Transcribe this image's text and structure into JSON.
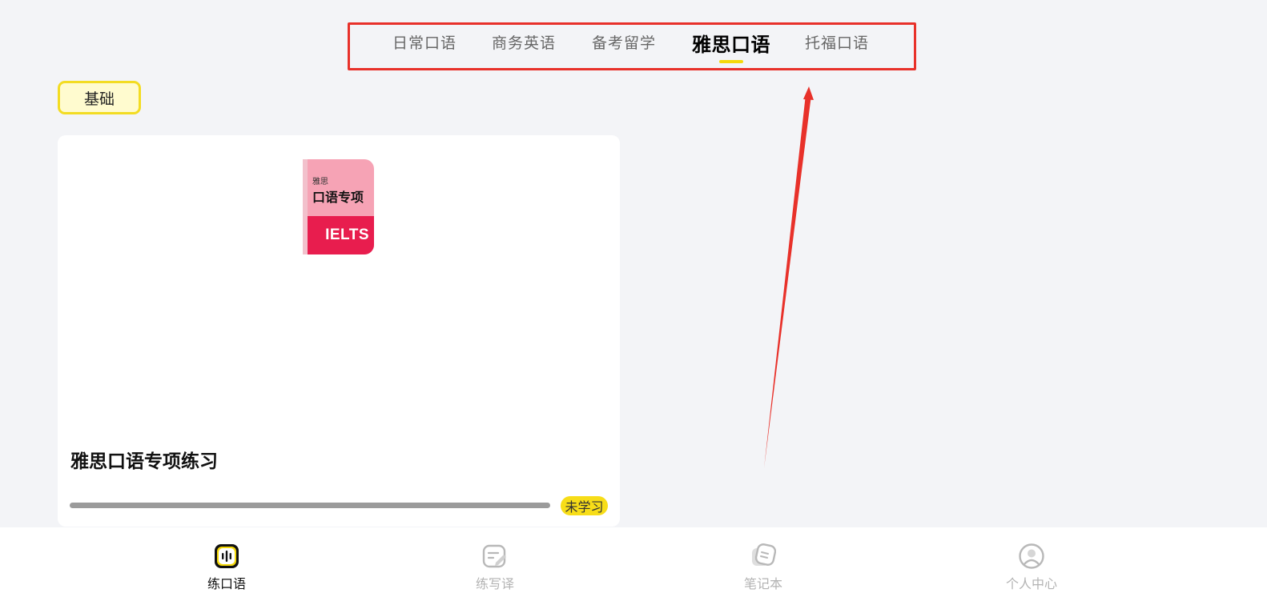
{
  "tabs": [
    {
      "label": "日常口语",
      "active": false
    },
    {
      "label": "商务英语",
      "active": false
    },
    {
      "label": "备考留学",
      "active": false
    },
    {
      "label": "雅思口语",
      "active": true
    },
    {
      "label": "托福口语",
      "active": false
    }
  ],
  "level_chip": {
    "label": "基础"
  },
  "course": {
    "cover_small": "雅思",
    "cover_big": "口语专项",
    "cover_brand": "IELTS",
    "title": "雅思口语专项练习",
    "progress": 0,
    "status": "未学习"
  },
  "bottom_nav": [
    {
      "label": "练口语",
      "icon": "speak-icon",
      "active": true
    },
    {
      "label": "练写译",
      "icon": "write-icon",
      "active": false
    },
    {
      "label": "笔记本",
      "icon": "notebook-icon",
      "active": false
    },
    {
      "label": "个人中心",
      "icon": "profile-icon",
      "active": false
    }
  ],
  "colors": {
    "accent_yellow": "#f5d90a",
    "annotation_red": "#e8312a",
    "cover_pink": "#f6a3b5",
    "cover_red": "#e81d4e"
  }
}
